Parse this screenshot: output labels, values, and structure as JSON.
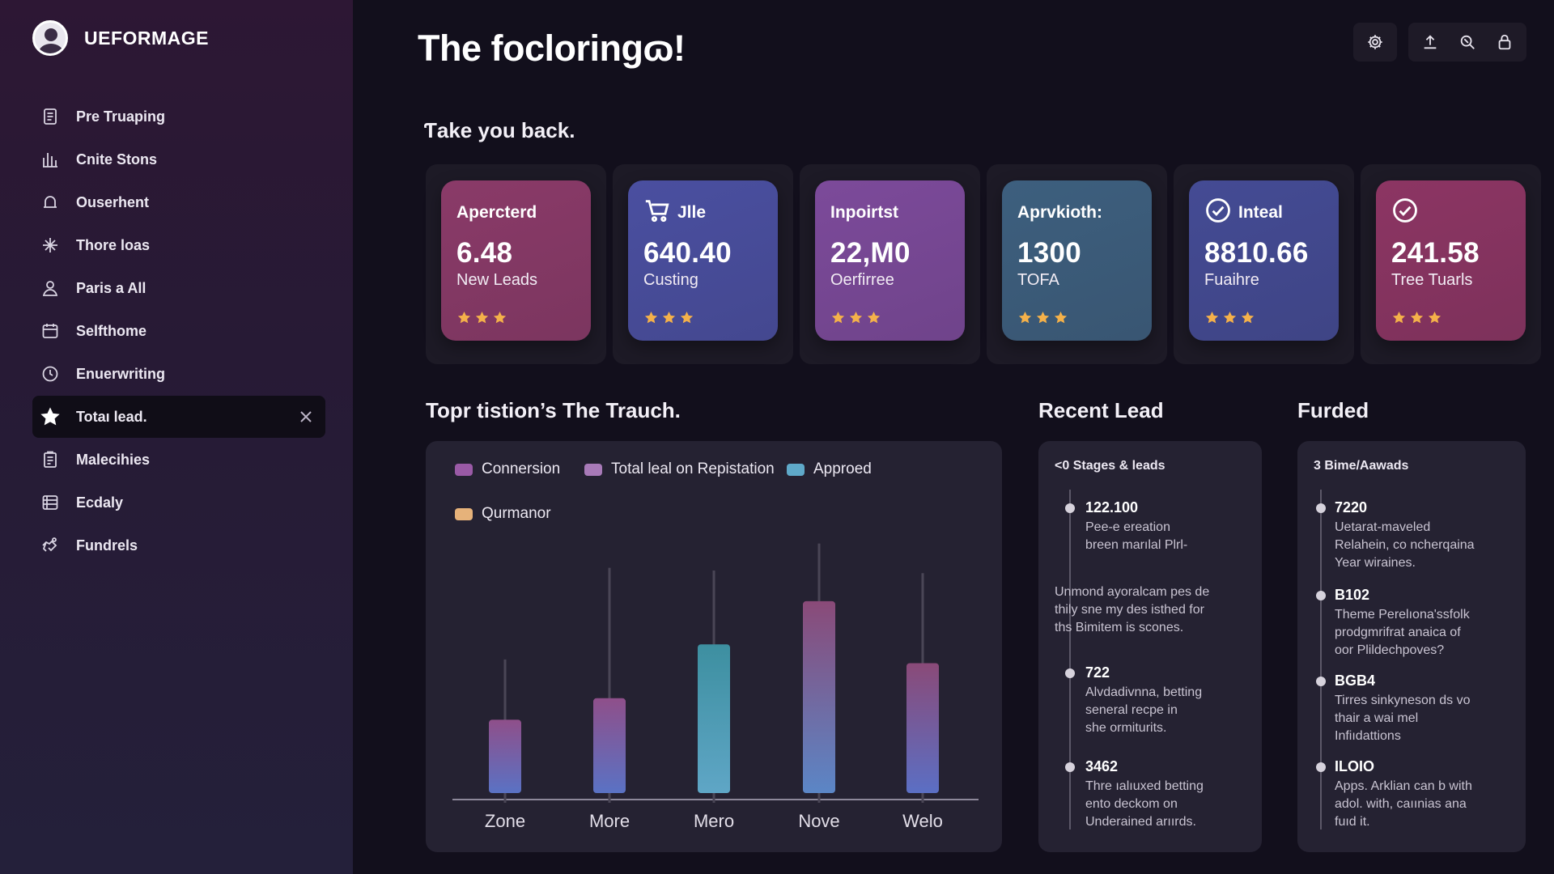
{
  "app": {
    "brand": "UEFORMAGE"
  },
  "sidebar": {
    "items": [
      {
        "label": "Pre Truaping",
        "icon": "document-list-icon"
      },
      {
        "label": "Cnite Stons",
        "icon": "bar-chart-icon"
      },
      {
        "label": "Ouserhent",
        "icon": "bell-icon"
      },
      {
        "label": "Thore loas",
        "icon": "sparkle-icon"
      },
      {
        "label": "Paris a All",
        "icon": "user-icon"
      },
      {
        "label": "Selfthome",
        "icon": "calendar-icon"
      },
      {
        "label": "Enuerwriting",
        "icon": "clock-icon"
      },
      {
        "label": "Totaı lead.",
        "icon": "star-icon",
        "active": true
      },
      {
        "label": "Malecihies",
        "icon": "clipboard-icon"
      },
      {
        "label": "Ecdaly",
        "icon": "list-icon"
      },
      {
        "label": "Fundrels",
        "icon": "handshake-icon"
      }
    ]
  },
  "header": {
    "title": "The focloringɷ!",
    "toolbar": [
      "settings-icon",
      "upload-icon",
      "search-zoom-icon",
      "lock-icon"
    ]
  },
  "kpi_section": {
    "heading": "Ƭake you back.",
    "cards": [
      {
        "title": "Apercterd",
        "value": "6.48",
        "label": "New Leads",
        "icon": "",
        "color": "#8a3a68",
        "stars": 3
      },
      {
        "title": "Jlle",
        "value": "640.40",
        "label": "Custing",
        "icon": "cart-icon",
        "color": "#4a4fa0",
        "stars": 3
      },
      {
        "title": "Inpoirtst",
        "value": "22,M0",
        "label": "Oerfirree",
        "icon": "",
        "color": "#7c4a9a",
        "stars": 3
      },
      {
        "title": "Aprvkioth:",
        "value": "1300",
        "label": "TOFA",
        "icon": "",
        "color": "#3d5f7e",
        "stars": 3
      },
      {
        "title": "Inteal",
        "value": "8810.66",
        "label": "Fuaihre",
        "icon": "check-circle-icon",
        "color": "#444b94",
        "stars": 3
      },
      {
        "title": "",
        "value": "241.58",
        "label": "Tree Tuarls",
        "icon": "check-circle-icon",
        "color": "#8c3563",
        "stars": 3
      }
    ]
  },
  "chart_section": {
    "heading": "Topr tistion’s The Trauch."
  },
  "chart_data": {
    "type": "bar",
    "categories": [
      "Zone",
      "More",
      "Mero",
      "Nove",
      "Welo"
    ],
    "series": [
      {
        "name": "Connersion",
        "color": "#9a5aa6"
      },
      {
        "name": "Total leal on Repistation",
        "color": "#a87ab8"
      },
      {
        "name": "Approed",
        "color": "#5fa9c9"
      },
      {
        "name": "Qurmanor",
        "color": "#e6b27a"
      }
    ],
    "values": [
      29,
      37,
      57,
      73,
      50
    ],
    "whisker_high": [
      52,
      86,
      85,
      95,
      84
    ],
    "bar_colors": [
      [
        "#8f4f8a",
        "#5a72c4"
      ],
      [
        "#8f4f8a",
        "#5a72c4"
      ],
      [
        "#3d8fa0",
        "#5fa6c6"
      ],
      [
        "#8a4a78",
        "#5b86c6"
      ],
      [
        "#8a4a78",
        "#5b6fc4"
      ]
    ],
    "ylim": [
      0,
      100
    ],
    "legend_position": "top",
    "grid": false
  },
  "recent_lead": {
    "heading": "Recent Lead",
    "header": "<0 Stages & leads",
    "entries": [
      {
        "num": "122.100",
        "text": [
          "Pee-e ereation",
          "breen marılal Plrl-"
        ]
      },
      {
        "num": "",
        "text": [
          "Unmond ayoralcam pes de",
          "thily sne my des isthed for",
          "ths Bimitem is scones."
        ]
      },
      {
        "num": "722",
        "text": [
          "Alvdadivnna, betting",
          "seneral recpe in",
          "she ormiturits."
        ]
      },
      {
        "num": "3462",
        "text": [
          "Thre ıalıuxed betting",
          "ento deckom on",
          "Underained arıırds."
        ]
      }
    ]
  },
  "furded": {
    "heading": "Furded",
    "header": "3 Bime/Aawads",
    "entries": [
      {
        "num": "7220",
        "text": [
          "Uetarat-maveled",
          "Relahein, co ncherqaina",
          "Year wiraines."
        ]
      },
      {
        "num": "B102",
        "text": [
          "Theme Perelıona'ssfolk",
          "prodgmrifrat anaica of",
          "oor Plildechpoves?"
        ]
      },
      {
        "num": "BGB4",
        "text": [
          "Tirres sinkyneson ds vo",
          "thair a wai mel",
          "Infiıdattions"
        ]
      },
      {
        "num": "ILOIO",
        "text": [
          "Apps. Arklian can b with",
          "adol. with, caıınias ana",
          "fuıd it."
        ]
      }
    ]
  }
}
